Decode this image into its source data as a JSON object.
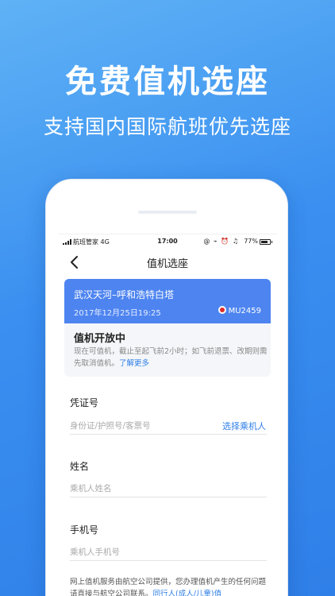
{
  "promo": {
    "headline": "免费值机选座",
    "subline": "支持国内国际航班优先选座"
  },
  "status_bar": {
    "carrier": "航班管家 4G",
    "time": "17:00",
    "icons": "@ ⌁ ⏰ ♫",
    "battery": "77%"
  },
  "nav": {
    "title": "值机选座"
  },
  "flight": {
    "route": "武汉天河–呼和浩特白塔",
    "datetime": "2017年12月25日19:25",
    "flight_no": "MU2459",
    "status_title": "值机开放中",
    "status_desc": "现在可值机，截止至起飞前2小时；如飞前退票、改期则需先取消值机。",
    "learn_more": "了解更多"
  },
  "form": {
    "id_label": "凭证号",
    "id_placeholder": "身份证/护照号/客票号",
    "pick_passenger": "选择乘机人",
    "name_label": "姓名",
    "name_placeholder": "乘机人姓名",
    "phone_label": "手机号",
    "phone_placeholder": "乘机人手机号"
  },
  "notice": {
    "text": "网上值机服务由航空公司提供，您办理值机产生的任何问题请直接与航空公司联系。",
    "link": "同行人(成人/儿童)值"
  },
  "colors": {
    "brand_blue": "#2f7fe8",
    "card_blue": "#4d84f0"
  }
}
